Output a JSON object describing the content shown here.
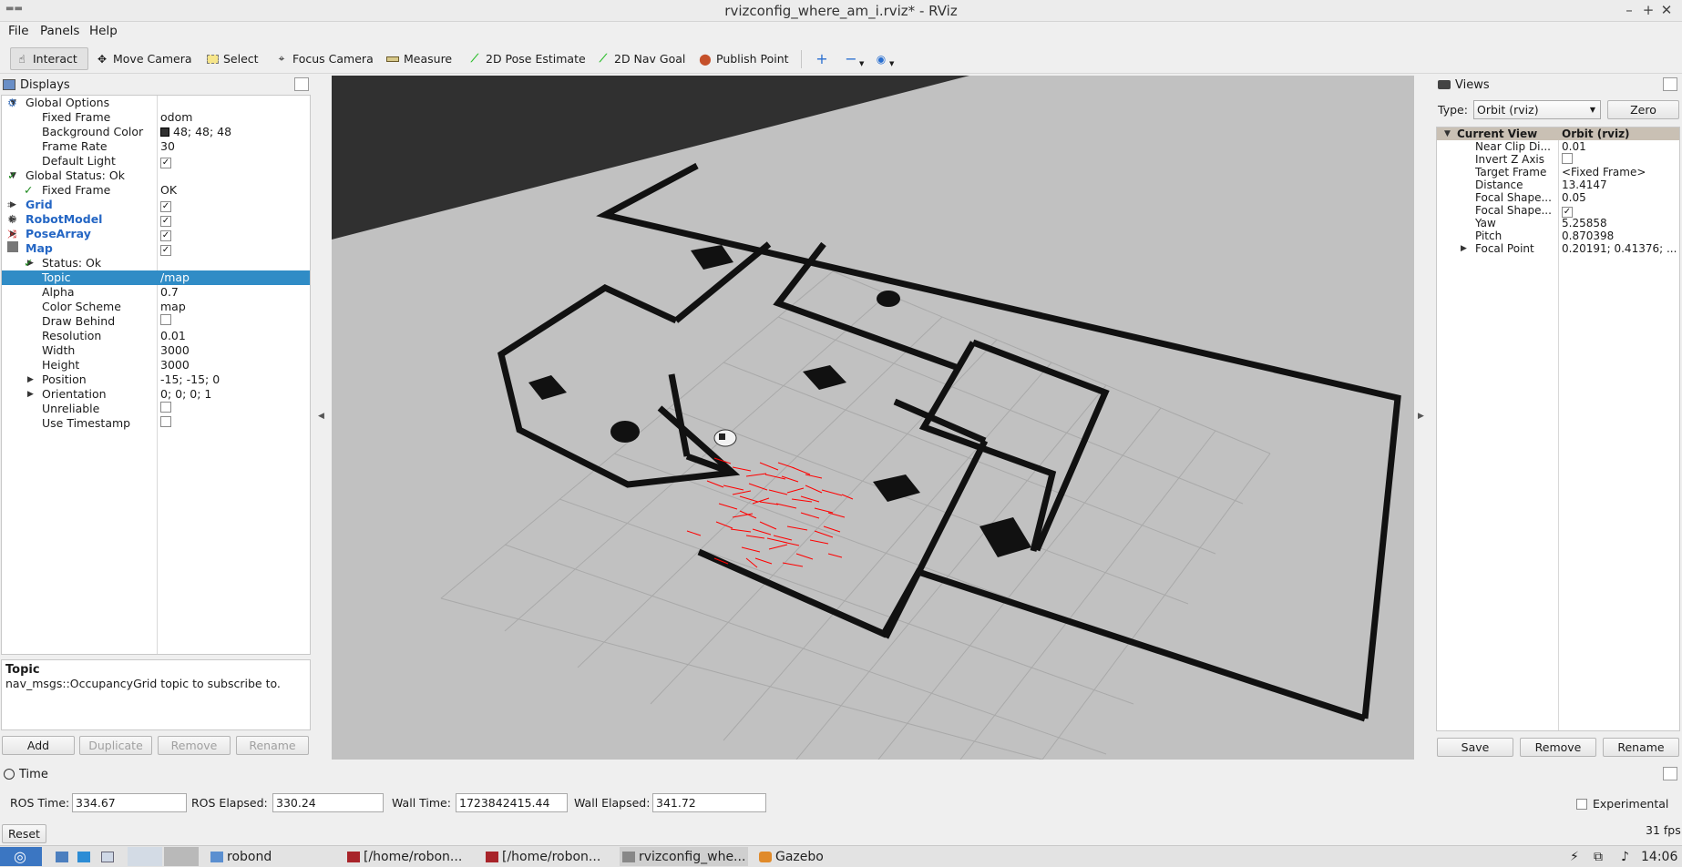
{
  "window": {
    "title": "rvizconfig_where_am_i.rviz* - RViz",
    "app_icon": "rviz-icon",
    "controls": [
      "–",
      "+",
      "✕"
    ]
  },
  "menu": [
    "File",
    "Panels",
    "Help"
  ],
  "toolbar": {
    "interact": "Interact",
    "move_camera": "Move Camera",
    "select": "Select",
    "focus_camera": "Focus Camera",
    "measure": "Measure",
    "pose_estimate": "2D Pose Estimate",
    "nav_goal": "2D Nav Goal",
    "publish_point": "Publish Point"
  },
  "displays": {
    "title": "Displays",
    "tree": [
      {
        "name": "Global Options",
        "value": "",
        "icon": "gear-icon",
        "expanded": true
      },
      {
        "name": "Fixed Frame",
        "value": "odom"
      },
      {
        "name": "Background Color",
        "value": "48; 48; 48",
        "swatch": "#303030"
      },
      {
        "name": "Frame Rate",
        "value": "30"
      },
      {
        "name": "Default Light",
        "value": "",
        "checked": true
      },
      {
        "name": "Global Status: Ok",
        "value": "",
        "icon": "check-icon",
        "expanded": true
      },
      {
        "name": "Fixed Frame",
        "value": "OK",
        "icon": "check-icon"
      },
      {
        "name": "Grid",
        "value": "",
        "checked": true,
        "icon": "grid-icon"
      },
      {
        "name": "RobotModel",
        "value": "",
        "checked": true,
        "icon": "robot-icon"
      },
      {
        "name": "PoseArray",
        "value": "",
        "checked": true,
        "icon": "posearray-icon"
      },
      {
        "name": "Map",
        "value": "",
        "checked": true,
        "icon": "map-icon",
        "expanded": true
      },
      {
        "name": "Status: Ok",
        "value": "",
        "icon": "check-icon"
      },
      {
        "name": "Topic",
        "value": "/map",
        "selected": true
      },
      {
        "name": "Alpha",
        "value": "0.7"
      },
      {
        "name": "Color Scheme",
        "value": "map"
      },
      {
        "name": "Draw Behind",
        "value": "",
        "checked": false
      },
      {
        "name": "Resolution",
        "value": "0.01"
      },
      {
        "name": "Width",
        "value": "3000"
      },
      {
        "name": "Height",
        "value": "3000"
      },
      {
        "name": "Position",
        "value": "-15; -15; 0"
      },
      {
        "name": "Orientation",
        "value": "0; 0; 0; 1"
      },
      {
        "name": "Unreliable",
        "value": "",
        "checked": false
      },
      {
        "name": "Use Timestamp",
        "value": "",
        "checked": false
      }
    ],
    "help_title": "Topic",
    "help_text": "nav_msgs::OccupancyGrid topic to subscribe to.",
    "buttons": {
      "add": "Add",
      "duplicate": "Duplicate",
      "remove": "Remove",
      "rename": "Rename"
    }
  },
  "views": {
    "title": "Views",
    "type_label": "Type:",
    "type_value": "Orbit (rviz)",
    "zero": "Zero",
    "tree": [
      {
        "name": "Current View",
        "value": "Orbit (rviz)"
      },
      {
        "name": "Near Clip Di...",
        "value": "0.01"
      },
      {
        "name": "Invert Z Axis",
        "value": "",
        "checked": false
      },
      {
        "name": "Target Frame",
        "value": "<Fixed Frame>"
      },
      {
        "name": "Distance",
        "value": "13.4147"
      },
      {
        "name": "Focal Shape...",
        "value": "0.05"
      },
      {
        "name": "Focal Shape...",
        "value": "",
        "checked": true
      },
      {
        "name": "Yaw",
        "value": "5.25858"
      },
      {
        "name": "Pitch",
        "value": "0.870398"
      },
      {
        "name": "Focal Point",
        "value": "0.20191; 0.41376; ..."
      }
    ],
    "buttons": {
      "save": "Save",
      "remove": "Remove",
      "rename": "Rename"
    }
  },
  "time": {
    "title": "Time",
    "ros_time_label": "ROS Time:",
    "ros_time": "334.67",
    "ros_elapsed_label": "ROS Elapsed:",
    "ros_elapsed": "330.24",
    "wall_time_label": "Wall Time:",
    "wall_time": "1723842415.44",
    "wall_elapsed_label": "Wall Elapsed:",
    "wall_elapsed": "341.72",
    "experimental": "Experimental",
    "reset": "Reset",
    "fps": "31 fps"
  },
  "taskbar": {
    "items": [
      "robond",
      "[/home/robon...",
      "[/home/robon...",
      "rvizconfig_whe...",
      "Gazebo"
    ],
    "clock": "14:06"
  },
  "colors": {
    "background": "#303030",
    "map_floor": "#c1c1c1",
    "wall": "#111111",
    "pose_arrow": "#ff0000",
    "selection": "#308cc6"
  }
}
